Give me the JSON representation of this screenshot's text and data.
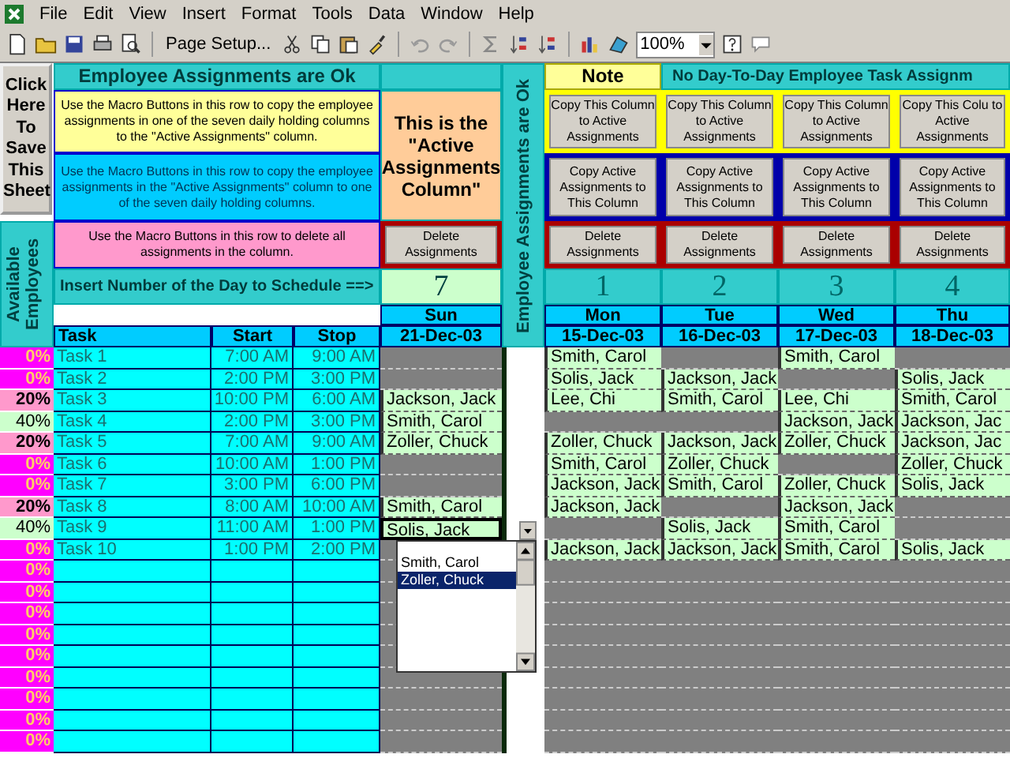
{
  "menu": [
    "File",
    "Edit",
    "View",
    "Insert",
    "Format",
    "Tools",
    "Data",
    "Window",
    "Help"
  ],
  "toolbar": {
    "page_setup": "Page Setup...",
    "zoom": "100%"
  },
  "save_button": "Click Here To Save This Sheet",
  "available_label": "Available Employees",
  "status_header": "Employee Assignments are Ok",
  "instructions": [
    {
      "kind": "copy_to_active",
      "text": "Use the Macro Buttons in this row to copy the employee assignments in one of the seven daily holding columns to the \"Active Assignments\" column."
    },
    {
      "kind": "copy_from_active",
      "text": "Use the Macro Buttons in this row to copy the employee assignments in the \"Active Assignments\" column to one of the seven daily holding columns."
    },
    {
      "kind": "delete",
      "text": "Use the Macro Buttons in this row to delete all assignments in the column."
    }
  ],
  "insert_prompt": "Insert Number of the Day to Schedule ==>",
  "columns": {
    "task": "Task",
    "start": "Start",
    "stop": "Stop"
  },
  "active_column": {
    "note": "This is the \"Active Assignments Column\"",
    "delete_button": "Delete Assignments",
    "day_number": "7",
    "day": "Sun",
    "date": "21-Dec-03",
    "cells": [
      {
        "editing": false
      },
      {
        "editing": false
      },
      {
        "name": "Jackson, Jack",
        "editing": false
      },
      {
        "name": "Smith, Carol",
        "editing": false
      },
      {
        "name": "Zoller, Chuck",
        "editing": false
      },
      {
        "editing": false
      },
      {
        "editing": false
      },
      {
        "name": "Smith, Carol",
        "editing": false
      },
      {
        "name": "Solis, Jack",
        "editing": true
      },
      {
        "editing": false
      }
    ]
  },
  "vertical_status": "Employee Assignments are Ok",
  "holding_note": "Note",
  "holding_header": "No Day-To-Day Employee Task Assignm",
  "holding_columns": [
    {
      "copy_to_active": "Copy This Column to Active Assignments",
      "copy_from_active": "Copy Active Assignments to This Column",
      "delete": "Delete Assignments",
      "day_number": "1",
      "day": "Mon",
      "date": "15-Dec-03",
      "cells": [
        "Smith, Carol",
        "Solis, Jack",
        "Lee, Chi",
        null,
        "Zoller, Chuck",
        "Smith, Carol",
        "Jackson, Jack",
        "Jackson, Jack",
        null,
        "Jackson, Jack"
      ]
    },
    {
      "copy_to_active": "Copy This Column to Active Assignments",
      "copy_from_active": "Copy Active Assignments to This Column",
      "delete": "Delete Assignments",
      "day_number": "2",
      "day": "Tue",
      "date": "16-Dec-03",
      "cells": [
        null,
        "Jackson, Jack",
        "Smith, Carol",
        null,
        "Jackson, Jack",
        "Zoller, Chuck",
        "Smith, Carol",
        null,
        "Solis, Jack",
        "Jackson, Jack"
      ]
    },
    {
      "copy_to_active": "Copy This Column to Active Assignments",
      "copy_from_active": "Copy Active Assignments to This Column",
      "delete": "Delete Assignments",
      "day_number": "3",
      "day": "Wed",
      "date": "17-Dec-03",
      "cells": [
        "Smith, Carol",
        null,
        "Lee, Chi",
        "Jackson, Jack",
        "Zoller, Chuck",
        null,
        "Zoller, Chuck",
        "Jackson, Jack",
        "Smith, Carol",
        "Smith, Carol"
      ]
    },
    {
      "copy_to_active": "Copy This Colu to Active Assignments",
      "copy_from_active": "Copy Active Assignments to This Column",
      "delete": "Delete Assignments",
      "day_number": "4",
      "day": "Thu",
      "date": "18-Dec-03",
      "cells": [
        null,
        "Solis, Jack",
        "Smith, Carol",
        "Jackson, Jac",
        "Jackson, Jac",
        "Zoller, Chuck",
        "Solis, Jack",
        null,
        null,
        "Solis, Jack"
      ]
    }
  ],
  "tasks": [
    {
      "available": "0%",
      "kind": "zero",
      "name": "Task 1",
      "start": "7:00 AM",
      "stop": "9:00 AM"
    },
    {
      "available": "0%",
      "kind": "zero",
      "name": "Task 2",
      "start": "2:00 PM",
      "stop": "3:00 PM"
    },
    {
      "available": "20%",
      "kind": "low",
      "name": "Task 3",
      "start": "10:00 PM",
      "stop": "6:00 AM"
    },
    {
      "available": "40%",
      "kind": "ok",
      "name": "Task 4",
      "start": "2:00 PM",
      "stop": "3:00 PM"
    },
    {
      "available": "20%",
      "kind": "low",
      "name": "Task 5",
      "start": "7:00 AM",
      "stop": "9:00 AM"
    },
    {
      "available": "0%",
      "kind": "zero",
      "name": "Task 6",
      "start": "10:00 AM",
      "stop": "1:00 PM"
    },
    {
      "available": "0%",
      "kind": "zero",
      "name": "Task 7",
      "start": "3:00 PM",
      "stop": "6:00 PM"
    },
    {
      "available": "20%",
      "kind": "low",
      "name": "Task  8",
      "start": "8:00 AM",
      "stop": "10:00 AM"
    },
    {
      "available": "40%",
      "kind": "ok",
      "name": "Task 9",
      "start": "11:00 AM",
      "stop": "1:00 PM"
    },
    {
      "available": "0%",
      "kind": "zero",
      "name": "Task 10",
      "start": "1:00 PM",
      "stop": "2:00 PM"
    }
  ],
  "extra_availability": [
    {
      "available": "0%",
      "kind": "zero"
    },
    {
      "available": "0%",
      "kind": "zero"
    },
    {
      "available": "0%",
      "kind": "zero"
    },
    {
      "available": "0%",
      "kind": "zero"
    },
    {
      "available": "0%",
      "kind": "zero"
    },
    {
      "available": "0%",
      "kind": "zero"
    },
    {
      "available": "0%",
      "kind": "zero"
    },
    {
      "available": "0%",
      "kind": "zero"
    },
    {
      "available": "0%",
      "kind": "zero"
    }
  ],
  "dropdown": {
    "items": [
      {
        "label": "Smith, Carol",
        "selected": false
      },
      {
        "label": "Zoller, Chuck",
        "selected": true
      }
    ]
  }
}
